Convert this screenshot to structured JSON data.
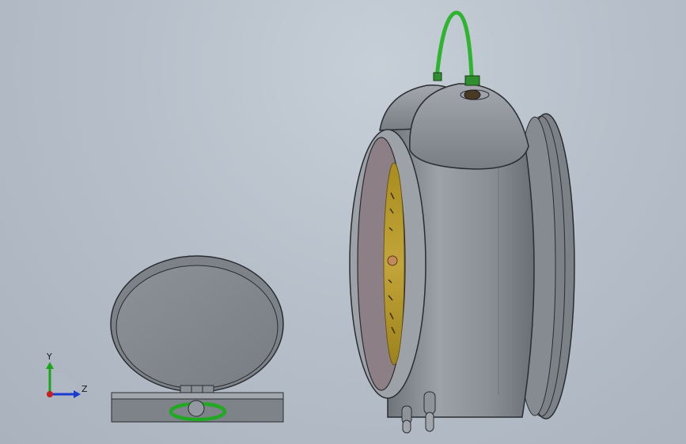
{
  "viewport": {
    "background_top": "#c6ced7",
    "background_bottom": "#a9b2bd"
  },
  "triad": {
    "y_label": "Y",
    "z_label": "Z",
    "y_color": "#1aa51a",
    "z_color": "#1a3bd1",
    "x_color": "#c81e1e"
  },
  "parts": {
    "lid_case": {
      "body_color": "#85898f",
      "ring_color": "#22a822"
    },
    "alarm_clock": {
      "body_color": "#8a8e95",
      "dial_color": "#b89a2a",
      "glass_color": "#8d7f86",
      "hanger_color": "#2fb42f"
    }
  }
}
